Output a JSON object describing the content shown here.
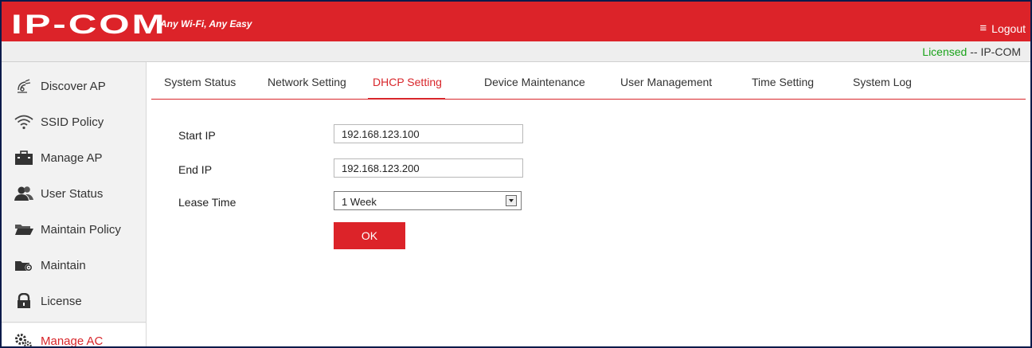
{
  "header": {
    "logo": "IP-COM",
    "tagline": "Any Wi-Fi, Any Easy",
    "logout_label": "Logout",
    "brand_color": "#dc2329"
  },
  "license": {
    "status": "Licensed",
    "separator": " -- ",
    "vendor": "IP-COM"
  },
  "sidebar": {
    "items": [
      {
        "label": "Discover AP",
        "icon": "radar-icon"
      },
      {
        "label": "SSID Policy",
        "icon": "wifi-icon"
      },
      {
        "label": "Manage AP",
        "icon": "briefcase-icon"
      },
      {
        "label": "User Status",
        "icon": "users-icon"
      },
      {
        "label": "Maintain Policy",
        "icon": "folder-icon"
      },
      {
        "label": "Maintain",
        "icon": "folder-gear-icon"
      },
      {
        "label": "License",
        "icon": "lock-icon"
      },
      {
        "label": "Manage AC",
        "icon": "gears-icon",
        "active": true
      }
    ]
  },
  "tabs": [
    {
      "label": "System Status"
    },
    {
      "label": "Network Setting"
    },
    {
      "label": "DHCP Setting",
      "active": true
    },
    {
      "label": "Device Maintenance"
    },
    {
      "label": "User Management"
    },
    {
      "label": "Time Setting"
    },
    {
      "label": "System Log"
    }
  ],
  "form": {
    "start_ip_label": "Start IP",
    "start_ip_value": "192.168.123.100",
    "end_ip_label": "End IP",
    "end_ip_value": "192.168.123.200",
    "lease_time_label": "Lease Time",
    "lease_time_value": "1 Week",
    "ok_label": "OK"
  }
}
